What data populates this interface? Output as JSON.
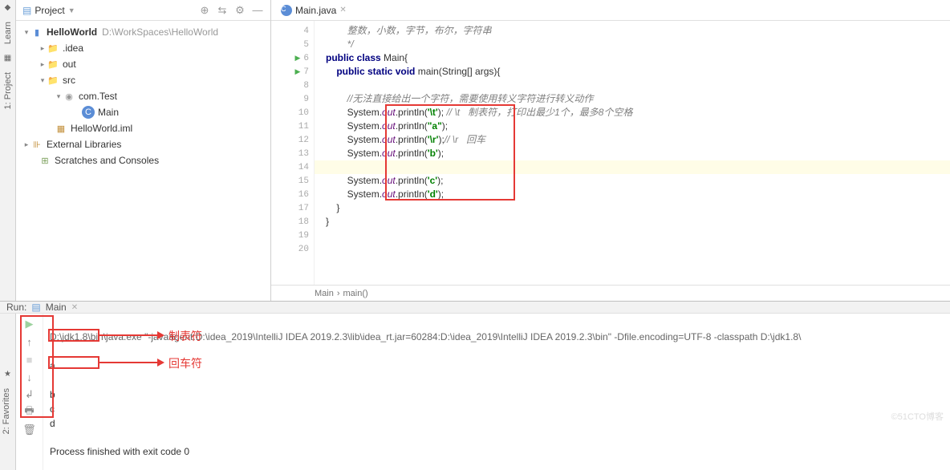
{
  "sidebar": {
    "tabs": [
      "Learn",
      "1: Project"
    ],
    "bottom_tabs": [
      "2: Favorites"
    ]
  },
  "project_panel": {
    "title": "Project",
    "root": {
      "name": "HelloWorld",
      "path": "D:\\WorkSpaces\\HelloWorld"
    },
    "items": [
      {
        "label": ".idea"
      },
      {
        "label": "out"
      },
      {
        "label": "src"
      },
      {
        "label": "com.Test"
      },
      {
        "label": "Main"
      },
      {
        "label": "HelloWorld.iml"
      }
    ],
    "extlib": "External Libraries",
    "scratches": "Scratches and Consoles"
  },
  "editor": {
    "tab": "Main.java",
    "lines": {
      "l4": "        整数，小数，字节，布尔，字符串",
      "l5": "        */",
      "l6a": "public class ",
      "l6b": "Main{",
      "l7a": "public static void ",
      "l7b": "main(String[] args){",
      "l9": "    //无法直接给出一个字符，需要使用转义字符进行转义动作",
      "l10a": "    System.",
      "l10b": "out",
      "l10c": ".println(",
      "l10d": "'\\t'",
      "l10e": ");",
      "l10f": " // \\t   制表符，打印出最少1个，最多8个空格",
      "l11a": "    System.",
      "l11b": "out",
      "l11c": ".println(",
      "l11d": "\"a\"",
      "l11e": ");",
      "l12a": "    System.",
      "l12b": "out",
      "l12c": ".println(",
      "l12d": "'\\r'",
      "l12e": ");",
      "l12f": "// \\r   回车",
      "l13a": "    System.",
      "l13b": "out",
      "l13c": ".println(",
      "l13d": "'b'",
      "l13e": ");",
      "l15a": "    System.",
      "l15b": "out",
      "l15c": ".println(",
      "l15d": "'c'",
      "l15e": ");",
      "l16a": "    System.",
      "l16b": "out",
      "l16c": ".println(",
      "l16d": "'d'",
      "l16e": ");",
      "l17": "}",
      "l18": "}"
    },
    "breadcrumb": {
      "a": "Main",
      "b": "main()"
    }
  },
  "run": {
    "label": "Run:",
    "tab": "Main",
    "cmd": "D:\\jdk1.8\\bin\\java.exe \"-javaagent:D:\\idea_2019\\IntelliJ IDEA 2019.2.3\\lib\\idea_rt.jar=60284:D:\\idea_2019\\IntelliJ IDEA 2019.2.3\\bin\" -Dfile.encoding=UTF-8 -classpath D:\\jdk1.8\\",
    "out_tab_spaces": "        ",
    "out_a": "a",
    "out_blank": " ",
    "out_b": "b",
    "out_c": "c",
    "out_d": "d",
    "finished": "Process finished with exit code 0"
  },
  "annotations": {
    "tab_label": "制表符",
    "cr_label": "回车符"
  },
  "watermark": "©51CTO博客"
}
